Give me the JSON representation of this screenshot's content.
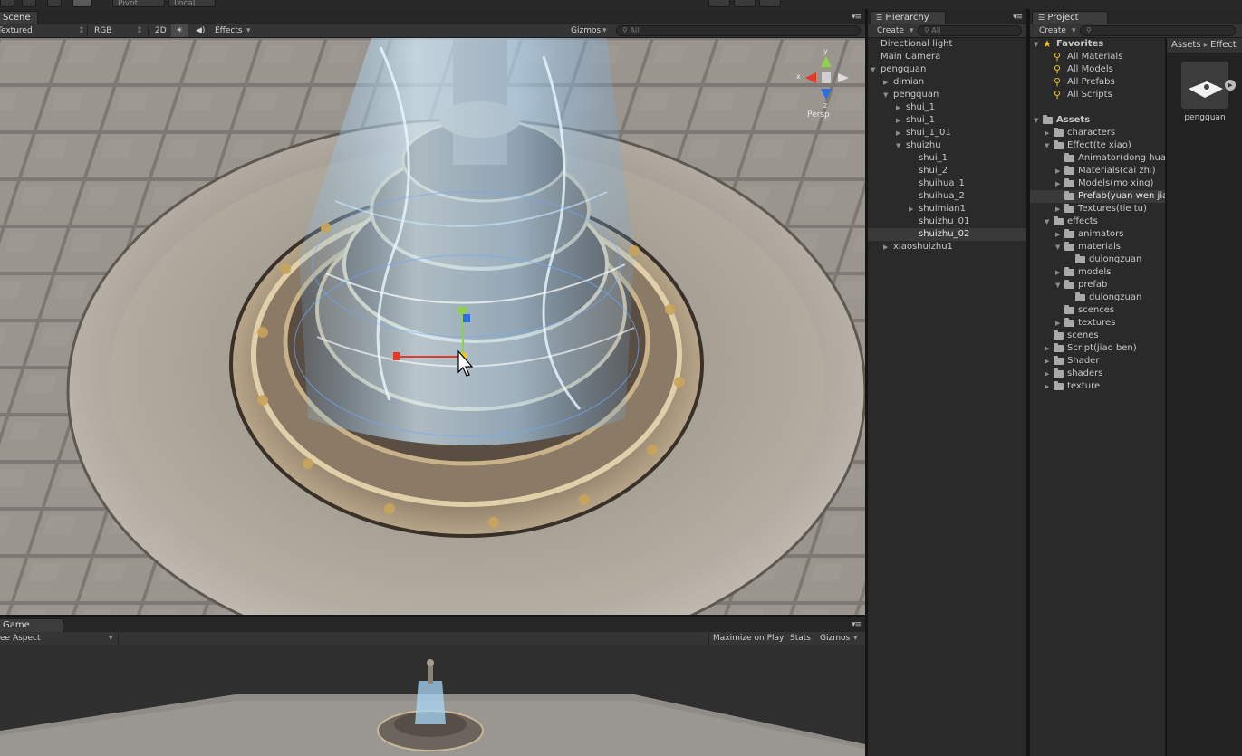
{
  "toolbar": {
    "pivot_label": "Pivot",
    "local_label": "Local"
  },
  "scene": {
    "tab_label": "Scene",
    "shading_mode": "Textured",
    "render_mode": "RGB",
    "mode_2d_label": "2D",
    "effects_label": "Effects",
    "gizmos_label": "Gizmos",
    "search_placeholder": "All",
    "gizmo_axes": {
      "y": "y",
      "x": "x",
      "z": "z"
    },
    "projection_label": "Persp"
  },
  "game": {
    "tab_label": "Game",
    "aspect_label": "Free Aspect",
    "maximize_label": "Maximize on Play",
    "stats_label": "Stats",
    "gizmos_label": "Gizmos"
  },
  "hierarchy": {
    "tab_label": "Hierarchy",
    "create_label": "Create",
    "search_placeholder": "All",
    "items": [
      {
        "label": "Directional light",
        "depth": 0,
        "expander": "none",
        "selected": false
      },
      {
        "label": "Main Camera",
        "depth": 0,
        "expander": "none",
        "selected": false
      },
      {
        "label": "pengquan",
        "depth": 0,
        "expander": "expanded",
        "selected": false
      },
      {
        "label": "dimian",
        "depth": 1,
        "expander": "collapsed",
        "selected": false
      },
      {
        "label": "pengquan",
        "depth": 1,
        "expander": "expanded",
        "selected": false
      },
      {
        "label": "shui_1",
        "depth": 2,
        "expander": "collapsed",
        "selected": false
      },
      {
        "label": "shui_1",
        "depth": 2,
        "expander": "collapsed",
        "selected": false
      },
      {
        "label": "shui_1_01",
        "depth": 2,
        "expander": "collapsed",
        "selected": false
      },
      {
        "label": "shuizhu",
        "depth": 2,
        "expander": "expanded",
        "selected": false
      },
      {
        "label": "shui_1",
        "depth": 3,
        "expander": "none",
        "selected": false
      },
      {
        "label": "shui_2",
        "depth": 3,
        "expander": "none",
        "selected": false
      },
      {
        "label": "shuihua_1",
        "depth": 3,
        "expander": "none",
        "selected": false
      },
      {
        "label": "shuihua_2",
        "depth": 3,
        "expander": "none",
        "selected": false
      },
      {
        "label": "shuimian1",
        "depth": 3,
        "expander": "collapsed",
        "selected": false
      },
      {
        "label": "shuizhu_01",
        "depth": 3,
        "expander": "none",
        "selected": false
      },
      {
        "label": "shuizhu_02",
        "depth": 3,
        "expander": "none",
        "selected": true
      },
      {
        "label": "xiaoshuizhu1",
        "depth": 1,
        "expander": "collapsed",
        "selected": false
      }
    ]
  },
  "project": {
    "tab_label": "Project",
    "create_label": "Create",
    "breadcrumb": [
      "Assets",
      "Effect"
    ],
    "tree": [
      {
        "label": "Favorites",
        "depth": 0,
        "kind": "star",
        "expander": "expanded",
        "bold": true,
        "selected": false
      },
      {
        "label": "All Materials",
        "depth": 1,
        "kind": "search",
        "expander": "none",
        "bold": false,
        "selected": false
      },
      {
        "label": "All Models",
        "depth": 1,
        "kind": "search",
        "expander": "none",
        "bold": false,
        "selected": false
      },
      {
        "label": "All Prefabs",
        "depth": 1,
        "kind": "search",
        "expander": "none",
        "bold": false,
        "selected": false
      },
      {
        "label": "All Scripts",
        "depth": 1,
        "kind": "search",
        "expander": "none",
        "bold": false,
        "selected": false
      },
      {
        "label": "",
        "depth": 0,
        "kind": "spacer",
        "expander": "none",
        "bold": false,
        "selected": false
      },
      {
        "label": "Assets",
        "depth": 0,
        "kind": "folder",
        "expander": "expanded",
        "bold": true,
        "selected": false
      },
      {
        "label": "characters",
        "depth": 1,
        "kind": "folder",
        "expander": "collapsed",
        "bold": false,
        "selected": false
      },
      {
        "label": "Effect(te xiao)",
        "depth": 1,
        "kind": "folder",
        "expander": "expanded",
        "bold": false,
        "selected": false
      },
      {
        "label": "Animator(dong hua)",
        "depth": 2,
        "kind": "folder",
        "expander": "none",
        "bold": false,
        "selected": false
      },
      {
        "label": "Materials(cai zhi)",
        "depth": 2,
        "kind": "folder",
        "expander": "collapsed",
        "bold": false,
        "selected": false
      },
      {
        "label": "Models(mo xing)",
        "depth": 2,
        "kind": "folder",
        "expander": "collapsed",
        "bold": false,
        "selected": false
      },
      {
        "label": "Prefab(yuan wen jian)",
        "depth": 2,
        "kind": "folder",
        "expander": "none",
        "bold": false,
        "selected": true
      },
      {
        "label": "Textures(tie tu)",
        "depth": 2,
        "kind": "folder",
        "expander": "collapsed",
        "bold": false,
        "selected": false
      },
      {
        "label": "effects",
        "depth": 1,
        "kind": "folder",
        "expander": "expanded",
        "bold": false,
        "selected": false
      },
      {
        "label": "animators",
        "depth": 2,
        "kind": "folder",
        "expander": "collapsed",
        "bold": false,
        "selected": false
      },
      {
        "label": "materials",
        "depth": 2,
        "kind": "folder",
        "expander": "expanded",
        "bold": false,
        "selected": false
      },
      {
        "label": "dulongzuan",
        "depth": 3,
        "kind": "folder",
        "expander": "none",
        "bold": false,
        "selected": false
      },
      {
        "label": "models",
        "depth": 2,
        "kind": "folder",
        "expander": "collapsed",
        "bold": false,
        "selected": false
      },
      {
        "label": "prefab",
        "depth": 2,
        "kind": "folder",
        "expander": "expanded",
        "bold": false,
        "selected": false
      },
      {
        "label": "dulongzuan",
        "depth": 3,
        "kind": "folder",
        "expander": "none",
        "bold": false,
        "selected": false
      },
      {
        "label": "scences",
        "depth": 2,
        "kind": "folder",
        "expander": "none",
        "bold": false,
        "selected": false
      },
      {
        "label": "textures",
        "depth": 2,
        "kind": "folder",
        "expander": "collapsed",
        "bold": false,
        "selected": false
      },
      {
        "label": "scenes",
        "depth": 1,
        "kind": "folder",
        "expander": "none",
        "bold": false,
        "selected": false
      },
      {
        "label": "Script(jiao ben)",
        "depth": 1,
        "kind": "folder",
        "expander": "collapsed",
        "bold": false,
        "selected": false
      },
      {
        "label": "Shader",
        "depth": 1,
        "kind": "folder",
        "expander": "collapsed",
        "bold": false,
        "selected": false
      },
      {
        "label": "shaders",
        "depth": 1,
        "kind": "folder",
        "expander": "collapsed",
        "bold": false,
        "selected": false
      },
      {
        "label": "texture",
        "depth": 1,
        "kind": "folder",
        "expander": "collapsed",
        "bold": false,
        "selected": false
      }
    ],
    "asset_items": [
      {
        "label": "pengquan",
        "icon": "prefab-icon"
      }
    ]
  },
  "colors": {
    "accent_yellow": "#f5c518",
    "gizmo_x": "#e03a2a",
    "gizmo_y": "#8ed14a",
    "gizmo_z": "#2d6fe0",
    "water_glow": "#8fd0ff"
  }
}
